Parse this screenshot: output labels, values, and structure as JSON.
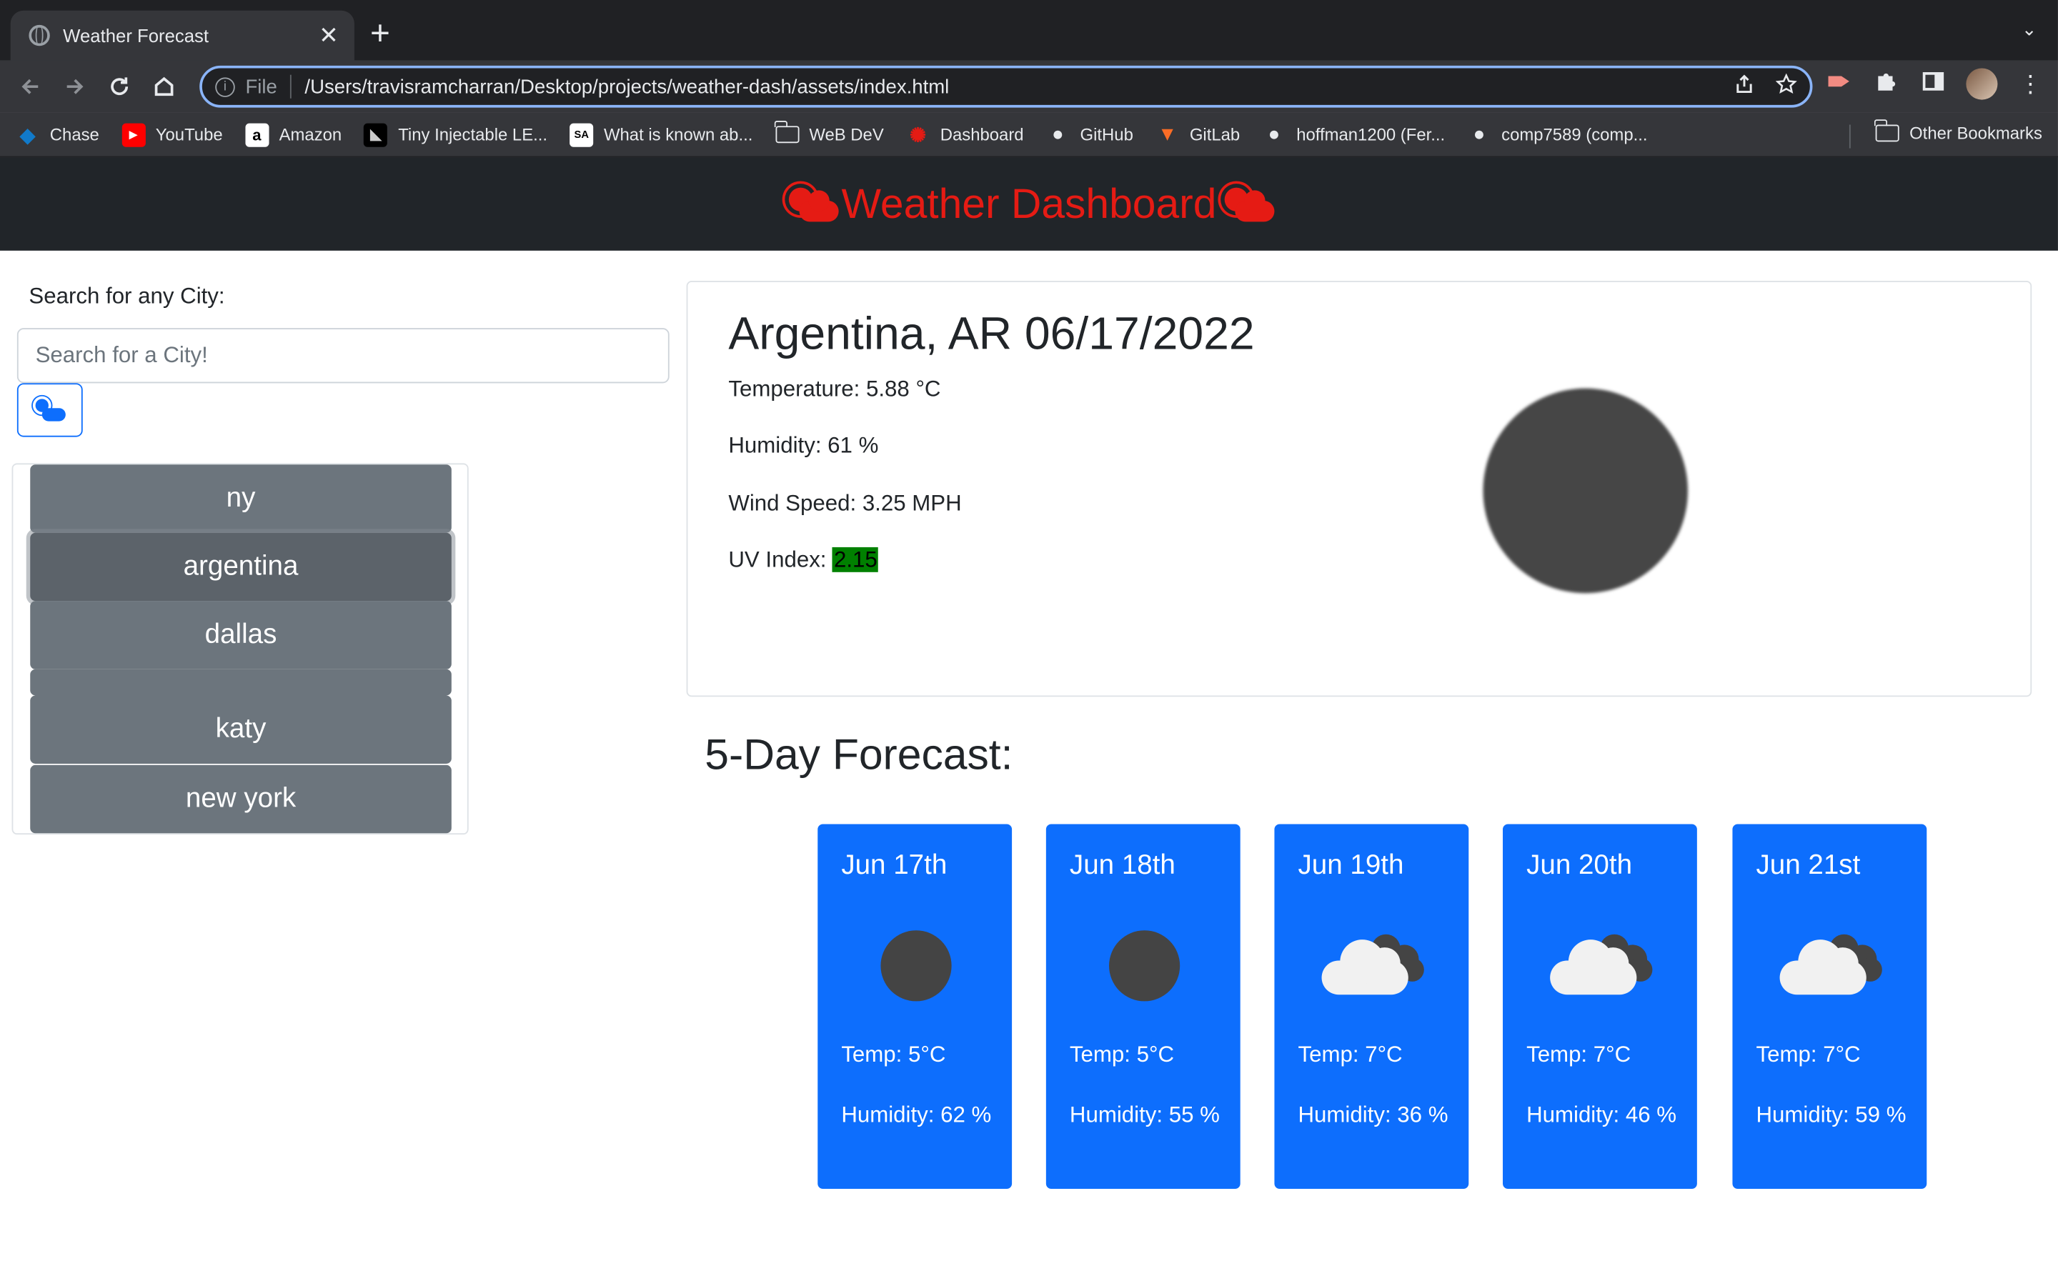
{
  "browser": {
    "tab_title": "Weather Forecast",
    "tab_close": "✕",
    "new_tab": "+",
    "tab_menu": "⌄",
    "omnibox": {
      "scheme_label": "File",
      "url": "/Users/travisramcharran/Desktop/projects/weather-dash/assets/index.html"
    },
    "bookmarks": [
      {
        "label": "Chase",
        "icon": "chase-icon",
        "color": "#117aca"
      },
      {
        "label": "YouTube",
        "icon": "youtube-icon",
        "color": "#ff0000"
      },
      {
        "label": "Amazon",
        "icon": "amazon-icon",
        "color": "#ffffff"
      },
      {
        "label": "Tiny Injectable LE...",
        "icon": "tiny-led-icon",
        "color": "#000000"
      },
      {
        "label": "What is known ab...",
        "icon": "sa-icon",
        "color": "#ffffff"
      },
      {
        "label": "WeB DeV",
        "icon": "folder-icon",
        "color": "#e8eaed"
      },
      {
        "label": "Dashboard",
        "icon": "dashboard-icon",
        "color": "#e51b14"
      },
      {
        "label": "GitHub",
        "icon": "github-icon",
        "color": "#e8eaed"
      },
      {
        "label": "GitLab",
        "icon": "gitlab-icon",
        "color": "#fc6d26"
      },
      {
        "label": "hoffman1200 (Fer...",
        "icon": "github-icon",
        "color": "#e8eaed"
      },
      {
        "label": "comp7589 (comp...",
        "icon": "github-icon",
        "color": "#e8eaed"
      }
    ],
    "other_bookmarks": "Other Bookmarks"
  },
  "header": {
    "title": "Weather Dashboard",
    "color": "#e51b14"
  },
  "search": {
    "label": "Search for any City:",
    "placeholder": "Search for a City!"
  },
  "history": [
    {
      "label": "ny",
      "active": false
    },
    {
      "label": "argentina",
      "active": true
    },
    {
      "label": "dallas",
      "active": false
    },
    {
      "label": "",
      "active": false
    },
    {
      "label": "katy",
      "active": false
    },
    {
      "label": "new york",
      "active": false
    }
  ],
  "current": {
    "title": "Argentina, AR 06/17/2022",
    "temperature": "Temperature: 5.88 °C",
    "humidity": "Humidity: 61 %",
    "wind": "Wind Speed: 3.25 MPH",
    "uv_label": "UV Index:",
    "uv_value": "2.15",
    "uv_color": "#008000",
    "icon": "moon-icon"
  },
  "forecast": {
    "title": "5-Day Forecast:",
    "days": [
      {
        "date": "Jun 17th",
        "icon": "moon-icon",
        "temp": "Temp: 5°C",
        "humidity": "Humidity: 62 %"
      },
      {
        "date": "Jun 18th",
        "icon": "moon-icon",
        "temp": "Temp: 5°C",
        "humidity": "Humidity: 55 %"
      },
      {
        "date": "Jun 19th",
        "icon": "clouds-icon",
        "temp": "Temp: 7°C",
        "humidity": "Humidity: 36 %"
      },
      {
        "date": "Jun 20th",
        "icon": "clouds-icon",
        "temp": "Temp: 7°C",
        "humidity": "Humidity: 46 %"
      },
      {
        "date": "Jun 21st",
        "icon": "clouds-icon",
        "temp": "Temp: 7°C",
        "humidity": "Humidity: 59 %"
      }
    ],
    "card_color": "#0d6efd"
  }
}
